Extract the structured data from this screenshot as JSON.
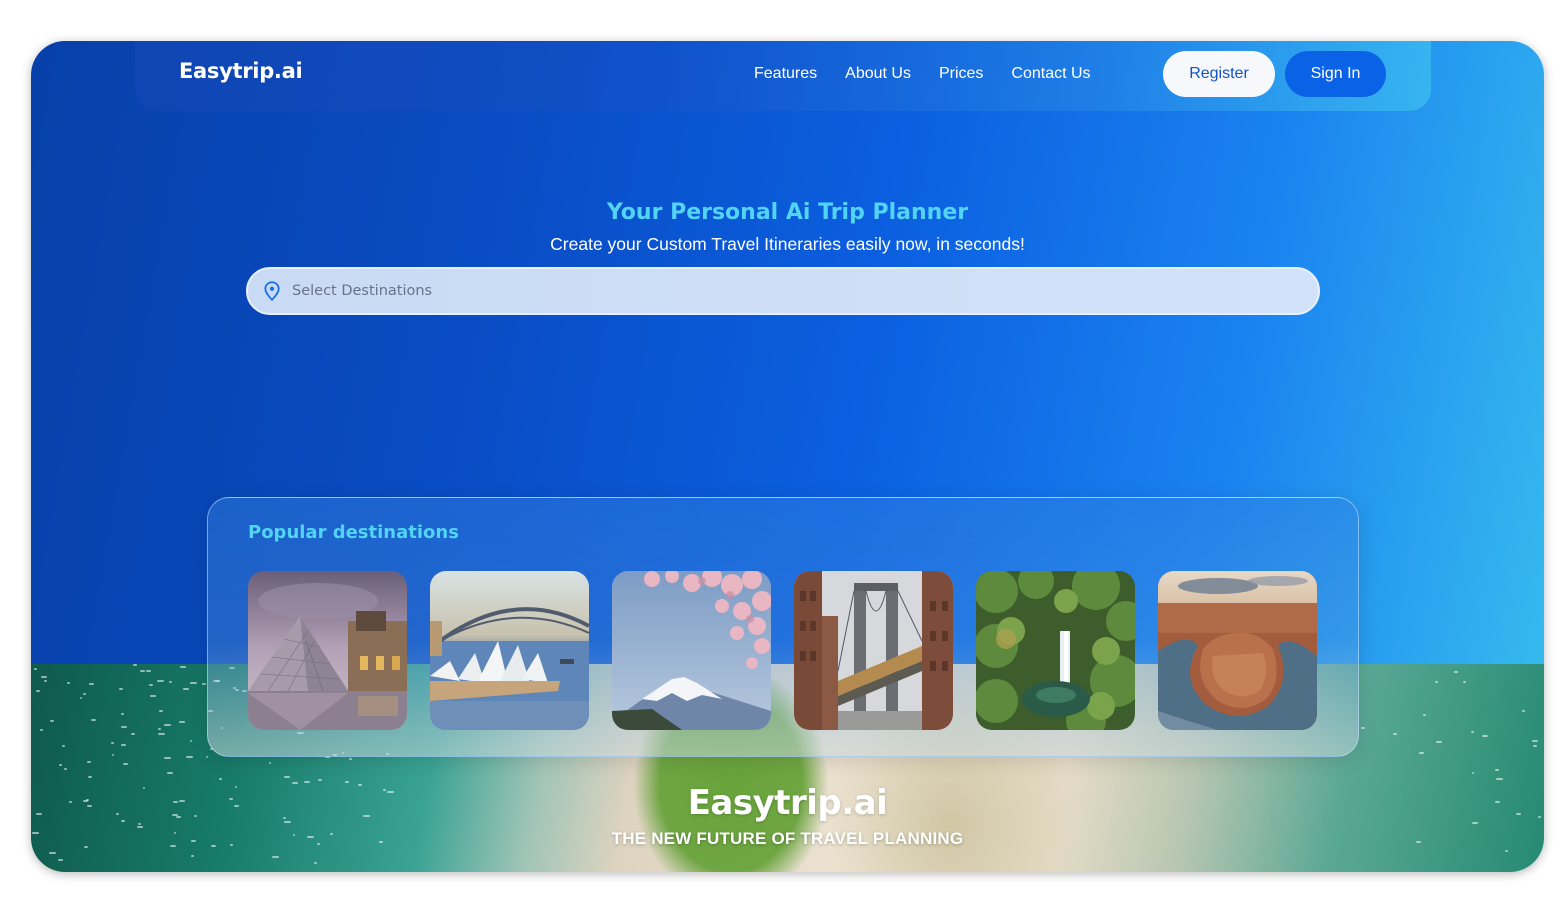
{
  "header": {
    "logo": "Easytrip.ai",
    "nav": [
      {
        "label": "Features"
      },
      {
        "label": "About Us"
      },
      {
        "label": "Prices"
      },
      {
        "label": "Contact Us"
      }
    ],
    "register_label": "Register",
    "signin_label": "Sign In"
  },
  "hero": {
    "title": "Your Personal Ai Trip Planner",
    "subtitle": "Create your Custom Travel Itineraries easily now, in seconds!",
    "search": {
      "placeholder": "Select Destinations",
      "value": "",
      "icon": "map-pin-icon"
    }
  },
  "popular": {
    "title": "Popular destinations",
    "destinations": [
      {
        "name": "Louvre Pyramid, Paris",
        "image": "louvre-image"
      },
      {
        "name": "Sydney Opera House",
        "image": "sydney-opera-image"
      },
      {
        "name": "Mount Fuji with cherry blossoms",
        "image": "mount-fuji-image"
      },
      {
        "name": "Manhattan Bridge, New York",
        "image": "manhattan-bridge-image"
      },
      {
        "name": "Jungle waterfall",
        "image": "waterfall-image"
      },
      {
        "name": "Horseshoe Bend",
        "image": "horseshoe-bend-image"
      }
    ]
  },
  "footer": {
    "logo": "Easytrip.ai",
    "tagline": "THE NEW FUTURE OF TRAVEL PLANNING"
  },
  "colors": {
    "accent_cyan": "#52d4f5",
    "signin_blue": "#0a63e6",
    "register_text": "#1453c4",
    "hero_start": "#0740a8",
    "hero_end": "#35b9ee"
  }
}
